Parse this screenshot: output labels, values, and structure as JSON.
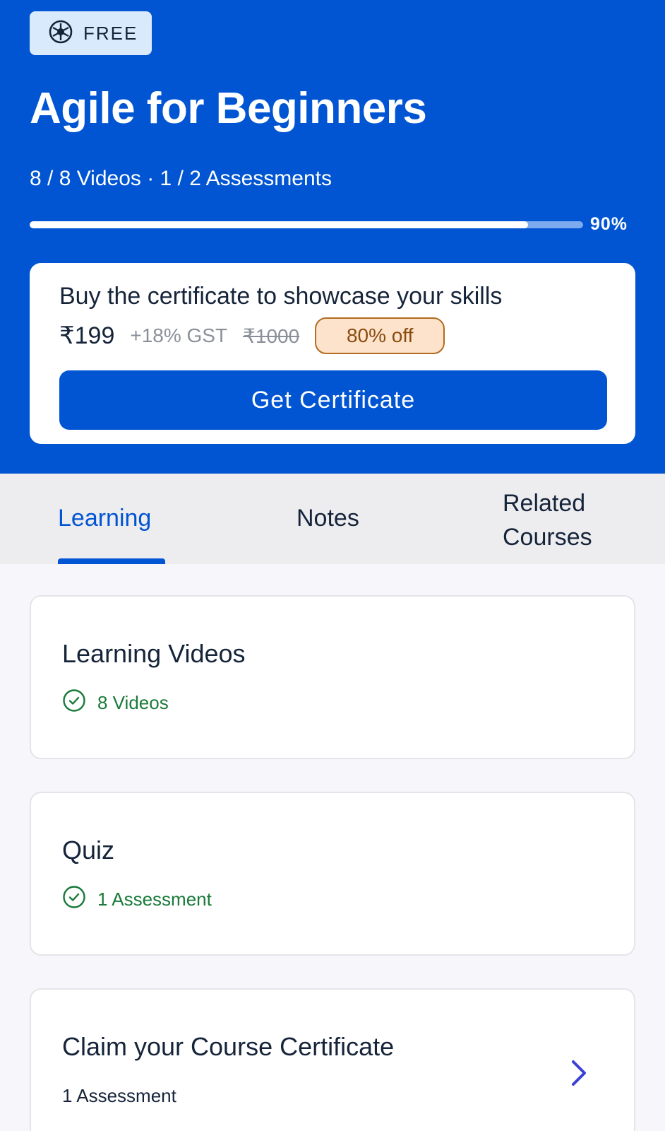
{
  "hero": {
    "badge_label": "FREE",
    "title": "Agile for Beginners",
    "meta": "8 / 8 Videos · 1 / 2 Assessments",
    "progress_fraction": 0.9,
    "progress_label": "90%"
  },
  "certificate": {
    "heading": "Buy the certificate to showcase your skills",
    "price": "₹199",
    "gst": "+18% GST",
    "original_price": "₹1000",
    "discount": "80% off",
    "button_label": "Get Certificate"
  },
  "tabs": [
    {
      "label": "Learning",
      "active": true
    },
    {
      "label": "Notes",
      "active": false
    },
    {
      "label": "Related Courses",
      "active": false
    }
  ],
  "sections": [
    {
      "title": "Learning Videos",
      "subtitle": "8 Videos",
      "completed": true
    },
    {
      "title": "Quiz",
      "subtitle": "1 Assessment",
      "completed": true
    },
    {
      "title": "Claim your Course Certificate",
      "subtitle": "1 Assessment",
      "completed": false
    }
  ],
  "colors": {
    "brand_blue": "#0155d3",
    "success_green": "#1a7a3a",
    "discount_bg": "#fde3cb",
    "discount_border": "#b26b1f"
  },
  "icons": {
    "badge": "free-badge-icon",
    "completed": "check-circle-icon",
    "navigate": "chevron-right-icon"
  }
}
